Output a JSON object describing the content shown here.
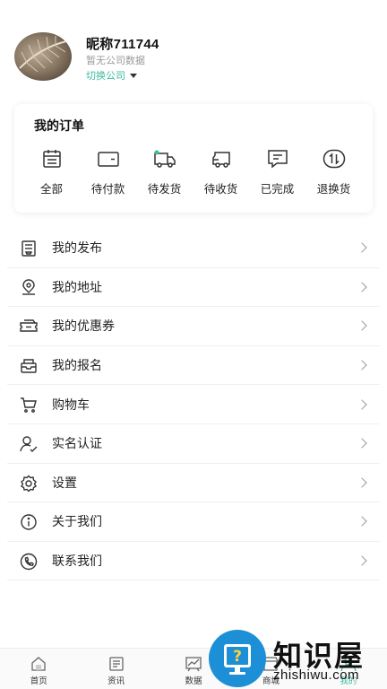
{
  "profile": {
    "nickname": "昵称711744",
    "company": "暂无公司数据",
    "switch_label": "切换公司"
  },
  "orders": {
    "title": "我的订单",
    "items": [
      {
        "label": "全部",
        "icon": "calendar-icon"
      },
      {
        "label": "待付款",
        "icon": "wallet-icon"
      },
      {
        "label": "待发货",
        "icon": "truck-icon"
      },
      {
        "label": "待收货",
        "icon": "delivery-icon"
      },
      {
        "label": "已完成",
        "icon": "message-icon"
      },
      {
        "label": "退换货",
        "icon": "exchange-icon"
      }
    ]
  },
  "menu": [
    {
      "label": "我的发布",
      "icon": "document-icon"
    },
    {
      "label": "我的地址",
      "icon": "location-icon"
    },
    {
      "label": "我的优惠券",
      "icon": "coupon-icon"
    },
    {
      "label": "我的报名",
      "icon": "inbox-icon"
    },
    {
      "label": "购物车",
      "icon": "cart-icon"
    },
    {
      "label": "实名认证",
      "icon": "user-check-icon"
    },
    {
      "label": "设置",
      "icon": "gear-icon"
    },
    {
      "label": "关于我们",
      "icon": "info-icon"
    },
    {
      "label": "联系我们",
      "icon": "phone-icon"
    }
  ],
  "tabbar": [
    {
      "label": "首页",
      "icon": "home-icon"
    },
    {
      "label": "资讯",
      "icon": "news-icon"
    },
    {
      "label": "数据",
      "icon": "chart-icon"
    },
    {
      "label": "商城",
      "icon": "shop-icon"
    },
    {
      "label": "我的",
      "icon": "profile-icon"
    }
  ],
  "watermark": {
    "text": "知识屋",
    "url": "zhishiwu.com"
  },
  "colors": {
    "accent": "#3dbb9e",
    "icon": "#333333",
    "watermark_blue": "#1d8fd6"
  }
}
